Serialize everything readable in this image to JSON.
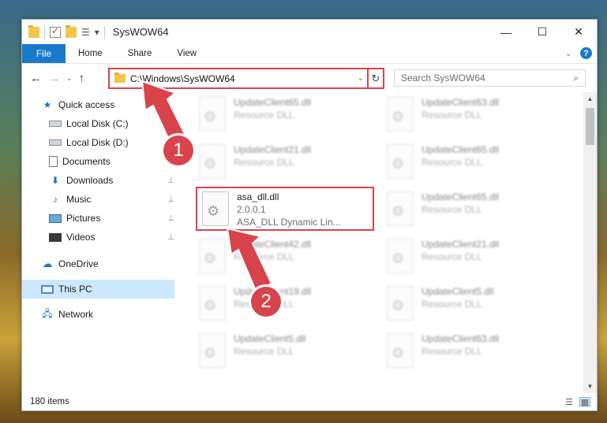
{
  "window": {
    "title": "SysWOW64",
    "controls": {
      "minimize": "—",
      "maximize": "☐",
      "close": "✕"
    }
  },
  "quick_access_toolbar": {
    "dropdown_glyph": "▾"
  },
  "ribbon": {
    "tabs": [
      "File",
      "Home",
      "Share",
      "View"
    ],
    "collapse_glyph": "⌄",
    "help_glyph": "?"
  },
  "navigation": {
    "back_glyph": "←",
    "forward_glyph": "→",
    "recent_glyph": "⌄",
    "up_glyph": "↑"
  },
  "address_bar": {
    "path": "C:\\Windows\\SysWOW64",
    "dropdown_glyph": "⌄",
    "refresh_glyph": "↻"
  },
  "search": {
    "placeholder": "Search SysWOW64",
    "icon_glyph": "⌕"
  },
  "nav_pane": {
    "quick_access": "Quick access",
    "items": [
      {
        "label": "Local Disk (C:)",
        "icon": "drive-icon",
        "pinned": false
      },
      {
        "label": "Local Disk (D:)",
        "icon": "drive-icon",
        "pinned": false
      },
      {
        "label": "Documents",
        "icon": "documents-icon",
        "pinned": true
      },
      {
        "label": "Downloads",
        "icon": "downloads-icon",
        "pinned": true
      },
      {
        "label": "Music",
        "icon": "music-icon",
        "pinned": true
      },
      {
        "label": "Pictures",
        "icon": "pictures-icon",
        "pinned": true
      },
      {
        "label": "Videos",
        "icon": "videos-icon",
        "pinned": true
      }
    ],
    "onedrive": "OneDrive",
    "this_pc": "This PC",
    "network": "Network",
    "pin_glyph": "📌"
  },
  "files": [
    {
      "name": "UpdateClient65.dll",
      "line2": "Resource DLL",
      "blurred": true
    },
    {
      "name": "UpdateClient63.dll",
      "line2": "Resource DLL",
      "blurred": true
    },
    {
      "name": "UpdateClient21.dll",
      "line2": "Resource DLL",
      "blurred": true
    },
    {
      "name": "UpdateClient65.dll",
      "line2": "Resource DLL",
      "blurred": true
    },
    {
      "name": "asa_dll.dll",
      "line2": "2.0.0.1",
      "line3": "ASA_DLL Dynamic Lin...",
      "blurred": false,
      "highlighted": true
    },
    {
      "name": "UpdateClient65.dll",
      "line2": "Resource DLL",
      "blurred": true
    },
    {
      "name": "UpdateClient42.dll",
      "line2": "Resource DLL",
      "blurred": true
    },
    {
      "name": "UpdateClient21.dll",
      "line2": "Resource DLL",
      "blurred": true
    },
    {
      "name": "UpdateClient19.dll",
      "line2": "Resource DLL",
      "blurred": true
    },
    {
      "name": "UpdateClient5.dll",
      "line2": "Resource DLL",
      "blurred": true
    },
    {
      "name": "UpdateClient5.dll",
      "line2": "Resource DLL",
      "blurred": true
    },
    {
      "name": "UpdateClient63.dll",
      "line2": "Resource DLL",
      "blurred": true
    }
  ],
  "scrollbar": {
    "up_glyph": "▲",
    "down_glyph": "▼"
  },
  "status": {
    "count": "180 items",
    "details_view_glyph": "☰",
    "tiles_view_glyph": "▦"
  },
  "annotations": {
    "step1": "1",
    "step2": "2",
    "color": "#d9434b"
  },
  "colors": {
    "accent": "#1979ca",
    "highlight": "#d9434b",
    "selection": "#cce8ff"
  }
}
